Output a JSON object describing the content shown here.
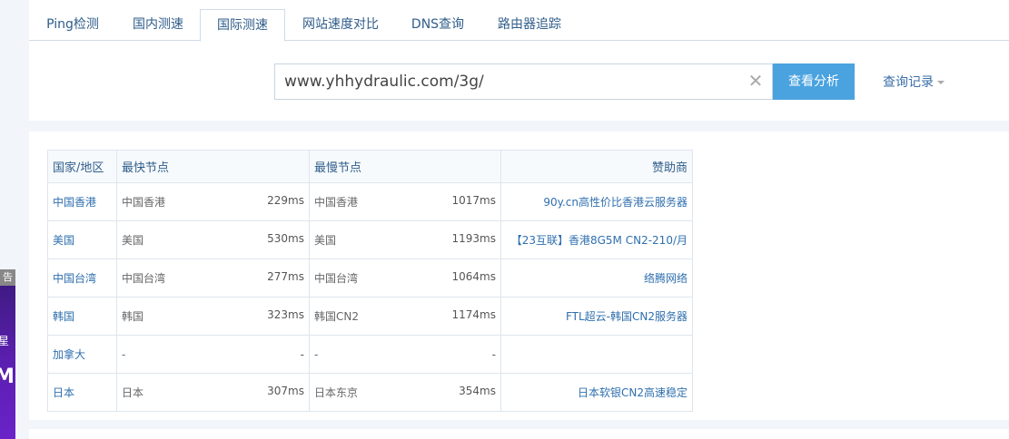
{
  "tabs": [
    "Ping检测",
    "国内测速",
    "国际测速",
    "网站速度对比",
    "DNS查询",
    "路由器追踪"
  ],
  "active_tab": 2,
  "search": {
    "value": "www.yhhydraulic.com/3g/",
    "button": "查看分析",
    "history": "查询记录"
  },
  "ad": {
    "tag": "告",
    "line1": "星",
    "line2": "M"
  },
  "table": {
    "headers": [
      "国家/地区",
      "最快节点",
      "最慢节点",
      "赞助商"
    ],
    "rows": [
      {
        "region": "中国香港",
        "fast_node": "中国香港",
        "fast_ms": "229ms",
        "slow_node": "中国香港",
        "slow_ms": "1017ms",
        "sponsor": "90y.cn高性价比香港云服务器"
      },
      {
        "region": "美国",
        "fast_node": "美国",
        "fast_ms": "530ms",
        "slow_node": "美国",
        "slow_ms": "1193ms",
        "sponsor": "【23互联】香港8G5M CN2-210/月"
      },
      {
        "region": "中国台湾",
        "fast_node": "中国台湾",
        "fast_ms": "277ms",
        "slow_node": "中国台湾",
        "slow_ms": "1064ms",
        "sponsor": "络腾网络"
      },
      {
        "region": "韩国",
        "fast_node": "韩国",
        "fast_ms": "323ms",
        "slow_node": "韩国CN2",
        "slow_ms": "1174ms",
        "sponsor": "FTL超云-韩国CN2服务器"
      },
      {
        "region": "加拿大",
        "fast_node": "-",
        "fast_ms": "-",
        "slow_node": "-",
        "slow_ms": "-",
        "sponsor": ""
      },
      {
        "region": "日本",
        "fast_node": "日本",
        "fast_ms": "307ms",
        "slow_node": "日本东京",
        "slow_ms": "354ms",
        "sponsor": "日本软银CN2高速稳定"
      }
    ]
  }
}
